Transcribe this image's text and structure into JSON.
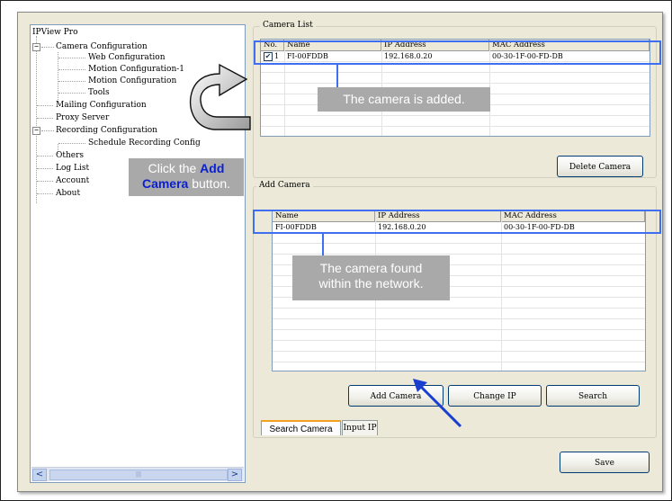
{
  "tree": {
    "items": [
      {
        "label": "IPView Pro",
        "level": 0
      },
      {
        "label": "Camera Configuration",
        "level": 1,
        "expander": "−"
      },
      {
        "label": "Web Configuration",
        "level": 2
      },
      {
        "label": "Motion Configuration-1",
        "level": 2
      },
      {
        "label": "Motion Configuration",
        "level": 2
      },
      {
        "label": "Tools",
        "level": 2
      },
      {
        "label": "Mailing Configuration",
        "level": 1
      },
      {
        "label": "Proxy Server",
        "level": 1
      },
      {
        "label": "Recording Configuration",
        "level": 1,
        "expander": "−"
      },
      {
        "label": "Schedule Recording Config",
        "level": 2
      },
      {
        "label": "Others",
        "level": 1
      },
      {
        "label": "Log List",
        "level": 1
      },
      {
        "label": "Account",
        "level": 1
      },
      {
        "label": "About",
        "level": 1
      }
    ],
    "scroll_left": "<",
    "scroll_right": ">",
    "scroll_grip": "|||"
  },
  "camera_list": {
    "title": "Camera List",
    "columns": [
      "No.",
      "Name",
      "IP Address",
      "MAC Address"
    ],
    "rows": [
      {
        "checked": true,
        "check_glyph": "✔",
        "no": "1",
        "name": "FI-00FDDB",
        "ip": "192.168.0.20",
        "mac": "00-30-1F-00-FD-DB"
      }
    ],
    "delete_button": "Delete Camera"
  },
  "add_camera": {
    "title": "Add Camera",
    "columns": [
      "Name",
      "IP Address",
      "MAC Address"
    ],
    "rows": [
      {
        "name": "FI-00FDDB",
        "ip": "192.168.0.20",
        "mac": "00-30-1F-00-FD-DB"
      }
    ],
    "buttons": {
      "add": "Add Camera",
      "change_ip": "Change IP",
      "search": "Search"
    },
    "tabs": {
      "search": "Search Camera",
      "input_ip": "Input IP"
    }
  },
  "save_button": "Save",
  "annotations": {
    "camera_added": "The camera is added.",
    "click_prefix": "Click the ",
    "click_bold_1": "Add",
    "click_bold_2": "Camera",
    "click_suffix": " button.",
    "camera_found_line1": "The camera found",
    "camera_found_line2": "within the network."
  },
  "colors": {
    "highlight": "#3f6ff0",
    "callout_bg": "#a9a9a9",
    "emphasis_text": "#0a1fd0"
  }
}
